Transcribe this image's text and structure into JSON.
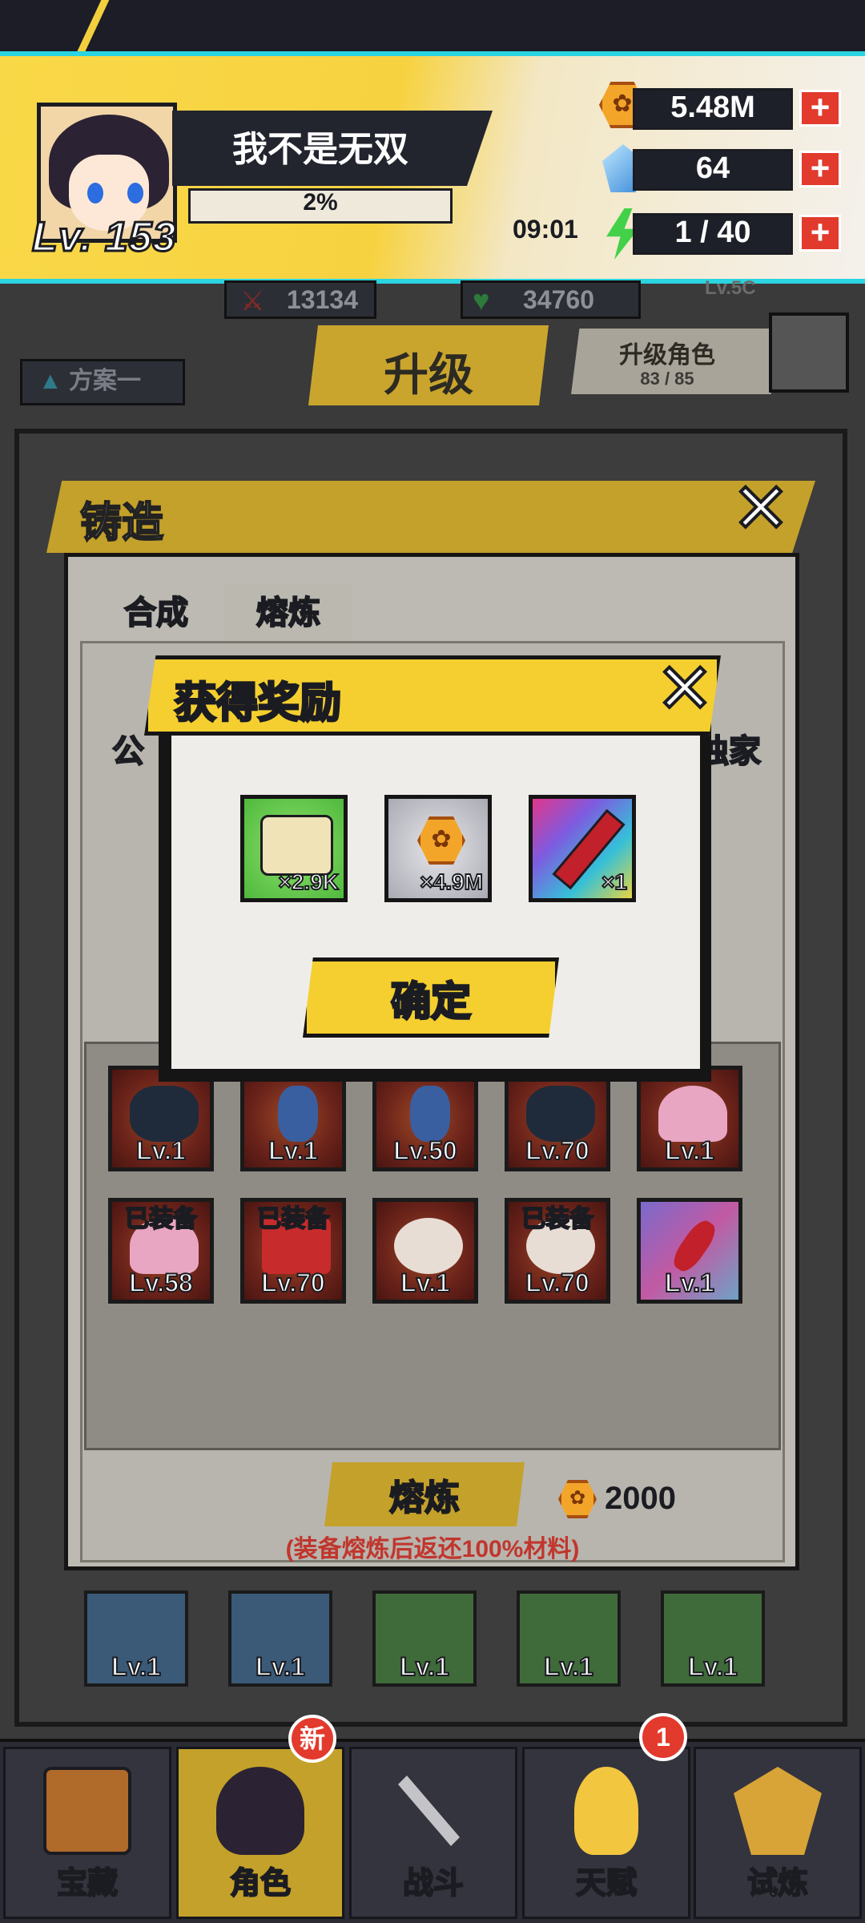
{
  "player": {
    "name": "我不是无双",
    "level": "Lv. 153",
    "exp_percent": "2%"
  },
  "resources": {
    "coins": "5.48M",
    "gems": "64",
    "energy": "1 / 40",
    "energy_timer": "09:01"
  },
  "stats": {
    "attack": "13134",
    "health": "34760",
    "level_tag": "Lv.5C"
  },
  "upgrade": {
    "label": "升级",
    "plan": "方案一",
    "role_title": "升级角色",
    "role_progress": "83 / 85"
  },
  "forge": {
    "title": "铸造",
    "tabs": [
      "合成",
      "熔炼"
    ],
    "active_tab": "熔炼",
    "side_label_left": "公",
    "side_label_right": "独家",
    "equipment": [
      {
        "level": "Lv.1",
        "equipped": "",
        "color": "red",
        "icon": "chest-armor-icon"
      },
      {
        "level": "Lv.1",
        "equipped": "",
        "color": "red",
        "icon": "boot-icon"
      },
      {
        "level": "Lv.50",
        "equipped": "",
        "color": "red",
        "icon": "boot-icon"
      },
      {
        "level": "Lv.70",
        "equipped": "",
        "color": "red",
        "icon": "chest-armor-icon"
      },
      {
        "level": "Lv.1",
        "equipped": "",
        "color": "red",
        "icon": "helmet-icon"
      },
      {
        "level": "Lv.58",
        "equipped": "已装备",
        "color": "red",
        "icon": "helmet-icon"
      },
      {
        "level": "Lv.70",
        "equipped": "已装备",
        "color": "red",
        "icon": "book-icon"
      },
      {
        "level": "Lv.1",
        "equipped": "",
        "color": "red",
        "icon": "ring-icon"
      },
      {
        "level": "Lv.70",
        "equipped": "已装备",
        "color": "red",
        "icon": "ring-icon"
      },
      {
        "level": "Lv.1",
        "equipped": "",
        "color": "rainbow",
        "icon": "sword-icon"
      }
    ],
    "smelt_label": "熔炼",
    "smelt_cost": "2000",
    "smelt_note": "(装备熔炼后返还100%材料)"
  },
  "lower_slots": [
    "Lv.1",
    "Lv.1",
    "Lv.1",
    "Lv.1",
    "Lv.1"
  ],
  "reward_dialog": {
    "title": "获得奖励",
    "items": [
      {
        "qty": "×2.9K",
        "icon": "scroll-icon",
        "bg": "green"
      },
      {
        "qty": "×4.9M",
        "icon": "paw-coin-icon",
        "bg": "gray"
      },
      {
        "qty": "×1",
        "icon": "red-sword-icon",
        "bg": "rainbow"
      }
    ],
    "confirm": "确定"
  },
  "nav": {
    "items": [
      {
        "label": "宝藏",
        "icon": "treasure-chest-icon"
      },
      {
        "label": "角色",
        "icon": "character-icon"
      },
      {
        "label": "战斗",
        "icon": "battle-icon"
      },
      {
        "label": "天赋",
        "icon": "lightbulb-icon"
      },
      {
        "label": "试炼",
        "icon": "trial-icon"
      }
    ],
    "active": "角色",
    "new_badge": "新",
    "talent_badge": "1"
  },
  "colors": {
    "accent_yellow": "#f5cf2f",
    "banner_cyan": "#2ad4e0",
    "plus_red": "#e23a2d",
    "note_red": "#c0362d"
  }
}
